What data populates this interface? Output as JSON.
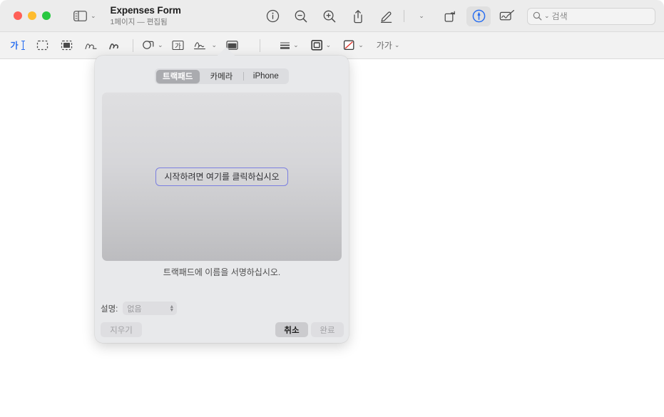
{
  "window": {
    "traffic_lights": [
      {
        "name": "close",
        "color": "#ff5f57"
      },
      {
        "name": "minimize",
        "color": "#febc2e"
      },
      {
        "name": "zoom",
        "color": "#28c840"
      }
    ]
  },
  "titlebar": {
    "sidebar_button_icon": "sidebar-icon",
    "sidebar_chevron": "⌄",
    "title": "Expenses Form",
    "subtitle": "1페이지 — 편집됨",
    "tools": [
      {
        "name": "info-icon",
        "label": "정보"
      },
      {
        "name": "zoom-out-icon",
        "label": "축소"
      },
      {
        "name": "zoom-in-icon",
        "label": "확대"
      },
      {
        "name": "share-icon",
        "label": "공유"
      },
      {
        "name": "markup-pen-icon",
        "label": "마크업"
      },
      {
        "name": "markup-pen-chevron",
        "label": "⌄"
      },
      {
        "name": "rotate-icon",
        "label": "회전"
      },
      {
        "name": "annotate-icon",
        "label": "주석",
        "active": true
      },
      {
        "name": "signature-toolbar-icon",
        "label": "서명"
      }
    ],
    "search": {
      "placeholder": "검색",
      "value": "",
      "icon": "search-icon",
      "chevron": "⌄"
    }
  },
  "markup_toolbar": {
    "items": [
      {
        "name": "text-selection-tool",
        "glyph": "가",
        "selected": true
      },
      {
        "name": "rectangular-selection-tool",
        "glyph": ""
      },
      {
        "name": "instant-alpha-tool",
        "glyph": ""
      },
      {
        "name": "sketch-tool",
        "glyph": ""
      },
      {
        "name": "draw-tool",
        "glyph": ""
      },
      {
        "name": "shapes-tool",
        "glyph": "",
        "chevron": "⌄"
      },
      {
        "name": "text-tool",
        "glyph": "가"
      },
      {
        "name": "signature-tool",
        "glyph": "",
        "chevron": "⌄",
        "active": true
      },
      {
        "name": "note-tool",
        "glyph": ""
      },
      {
        "name": "shape-style-tool",
        "glyph": "",
        "chevron": "⌄"
      },
      {
        "name": "border-color-tool",
        "glyph": "",
        "chevron": "⌄"
      },
      {
        "name": "fill-color-tool",
        "glyph": "",
        "chevron": "⌄"
      },
      {
        "name": "text-style-tool",
        "glyph": "가가",
        "chevron": "⌄"
      }
    ]
  },
  "signature_popover": {
    "segmented": {
      "options": [
        "트랙패드",
        "카메라",
        "iPhone"
      ],
      "selected": "트랙패드"
    },
    "pad": {
      "start_prompt": "시작하려면 여기를 클릭하십시오"
    },
    "hint": "트랙패드에 이름을 서명하십시오.",
    "description": {
      "label": "설명:",
      "value": "없음",
      "stepper_up": "▲",
      "stepper_down": "▼"
    },
    "buttons": {
      "clear": "지우기",
      "cancel": "취소",
      "done": "완료"
    }
  }
}
